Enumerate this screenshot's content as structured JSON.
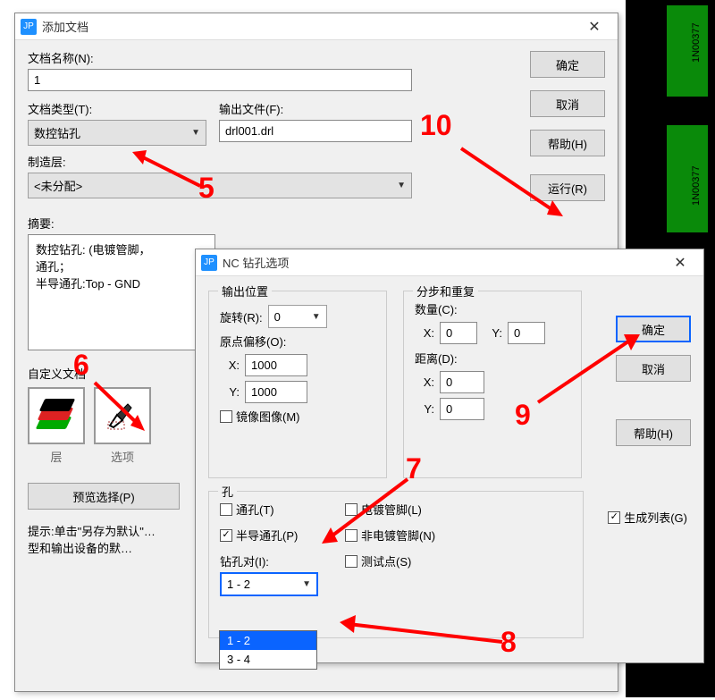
{
  "bg": {
    "chip_label": "1N00377"
  },
  "dlg1": {
    "title": "添加文档",
    "name_label": "文档名称(N):",
    "name_value": "1",
    "type_label": "文档类型(T):",
    "type_value": "数控钻孔",
    "output_label": "输出文件(F):",
    "output_value": "drl001.drl",
    "layer_label": "制造层:",
    "layer_value": "<未分配>",
    "summary_label": "摘要:",
    "summary_text": "数控钻孔: (电镀管脚，\n通孔；\n半导通孔:Top - GND",
    "custom_label": "自定义文档",
    "layers_btn_label": "层",
    "options_btn_label": "选项",
    "preview_btn": "预览选择(P)",
    "hint": "提示:单击\"另存为默认\"…\n        型和输出设备的默…",
    "buttons": {
      "ok": "确定",
      "cancel": "取消",
      "help": "帮助(H)",
      "run": "运行(R)"
    }
  },
  "dlg2": {
    "title": "NC 钻孔选项",
    "output_pos": "输出位置",
    "rotate_label": "旋转(R):",
    "rotate_value": "0",
    "origin_label": "原点偏移(O):",
    "x_label": "X:",
    "y_label": "Y:",
    "origin_x": "1000",
    "origin_y": "1000",
    "mirror_label": "镜像图像(M)",
    "step_repeat": "分步和重复",
    "count_label": "数量(C):",
    "count_x": "0",
    "count_y": "0",
    "dist_label": "距离(D):",
    "dist_x": "0",
    "dist_y": "0",
    "holes": "孔",
    "through_label": "通孔(T)",
    "semi_label": "半导通孔(P)",
    "plated_label": "电镀管脚(L)",
    "nonplated_label": "非电镀管脚(N)",
    "testpoint_label": "测试点(S)",
    "drillpair_label": "钻孔对(I):",
    "drillpair_value": "1 - 2",
    "drillpair_options": [
      "1 - 2",
      "3 - 4"
    ],
    "genlist_label": "生成列表(G)",
    "buttons": {
      "ok": "确定",
      "cancel": "取消",
      "help": "帮助(H)"
    }
  },
  "anno": {
    "5": "5",
    "6": "6",
    "7": "7",
    "8": "8",
    "9": "9",
    "10": "10"
  }
}
